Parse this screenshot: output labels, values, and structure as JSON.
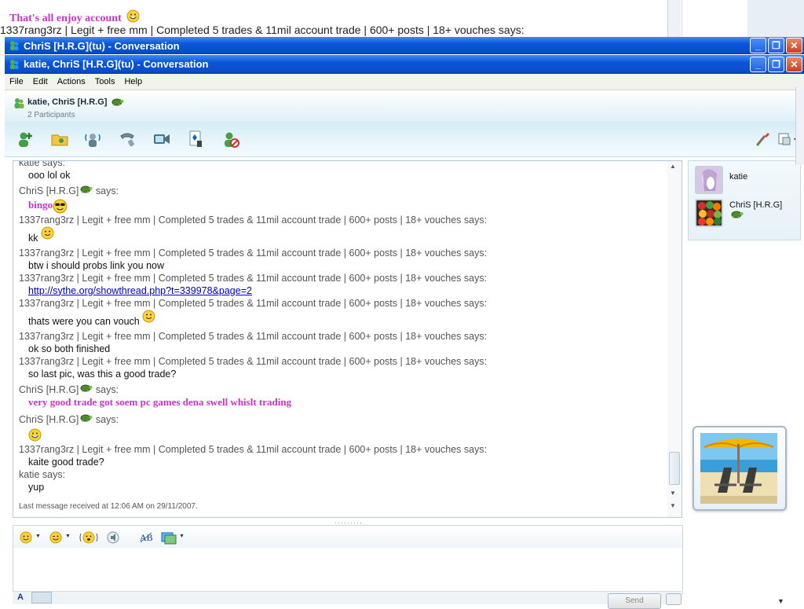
{
  "background_window": {
    "line1": "That's all enjoy account",
    "line2": "1337rang3rz | Legit + free mm | Completed 5 trades & 11mil account trade | 600+ posts | 18+ vouches says:",
    "title": "ChriS [H.R.G](tu) - Conversation"
  },
  "window": {
    "title": "katie, ChriS [H.R.G](tu) - Conversation"
  },
  "menu": [
    "File",
    "Edit",
    "Actions",
    "Tools",
    "Help"
  ],
  "header": {
    "participants": "katie, ChriS [H.R.G]",
    "count": "2 Participants"
  },
  "toolbar_icons": [
    "invite-contact-icon",
    "share-folder-icon",
    "voice-call-icon",
    "phone-icon",
    "video-icon",
    "games-icon",
    "block-icon",
    "paintbrush-icon",
    "display-options-icon"
  ],
  "conversation": [
    {
      "sender": "katie",
      "says": "says:",
      "text": "ooo lol ok"
    },
    {
      "sender": "ChriS [H.R.G]",
      "says": "says:",
      "text": "bingo",
      "pink": true,
      "emoticon": "cool",
      "turtle": true
    },
    {
      "sender": "1337rang3rz | Legit + free mm | Completed 5 trades & 11mil account trade | 600+ posts | 18+ vouches",
      "says": "says:",
      "text": "kk",
      "emoticon": "smile"
    },
    {
      "sender": "1337rang3rz | Legit + free mm | Completed 5 trades & 11mil account trade | 600+ posts | 18+ vouches",
      "says": "says:",
      "text": "btw i should probs link you now"
    },
    {
      "sender": "1337rang3rz | Legit + free mm | Completed 5 trades & 11mil account trade | 600+ posts | 18+ vouches",
      "says": "says:",
      "text": "http://sythe.org/showthread.php?t=339978&page=2",
      "link": true
    },
    {
      "sender": "1337rang3rz | Legit + free mm | Completed 5 trades & 11mil account trade | 600+ posts | 18+ vouches",
      "says": "says:",
      "text": "thats were you can vouch",
      "emoticon": "smile"
    },
    {
      "sender": "1337rang3rz | Legit + free mm | Completed 5 trades & 11mil account trade | 600+ posts | 18+ vouches",
      "says": "says:",
      "text": "ok so both finished"
    },
    {
      "sender": "1337rang3rz | Legit + free mm | Completed 5 trades & 11mil account trade | 600+ posts | 18+ vouches",
      "says": "says:",
      "text": "so last pic, was this a good trade?"
    },
    {
      "sender": "ChriS [H.R.G]",
      "says": "says:",
      "text": "very good trade got soem pc games dena swell whislt trading",
      "pink": true,
      "turtle": true
    },
    {
      "sender": "ChriS [H.R.G]",
      "says": "says:",
      "text": "",
      "emoticon": "grin",
      "turtle": true
    },
    {
      "sender": "1337rang3rz | Legit + free mm | Completed 5 trades & 11mil account trade | 600+ posts | 18+ vouches",
      "says": "says:",
      "text": "kaite good trade?"
    },
    {
      "sender": "katie",
      "says": "says:",
      "text": "yup"
    }
  ],
  "last_message": "Last message received at 12:06 AM on 29/11/2007.",
  "input_toolbar_icons": [
    "emoticon-icon",
    "wink-icon",
    "nudge-icon",
    "voice-clip-icon",
    "font-icon",
    "background-icon"
  ],
  "send_label": "Send",
  "participants": [
    {
      "name": "katie"
    },
    {
      "name": "ChriS [H.R.G]"
    }
  ],
  "colors": {
    "titlebar": "#0a55d8",
    "pink_text": "#cc33cc",
    "link": "#0000cc"
  }
}
